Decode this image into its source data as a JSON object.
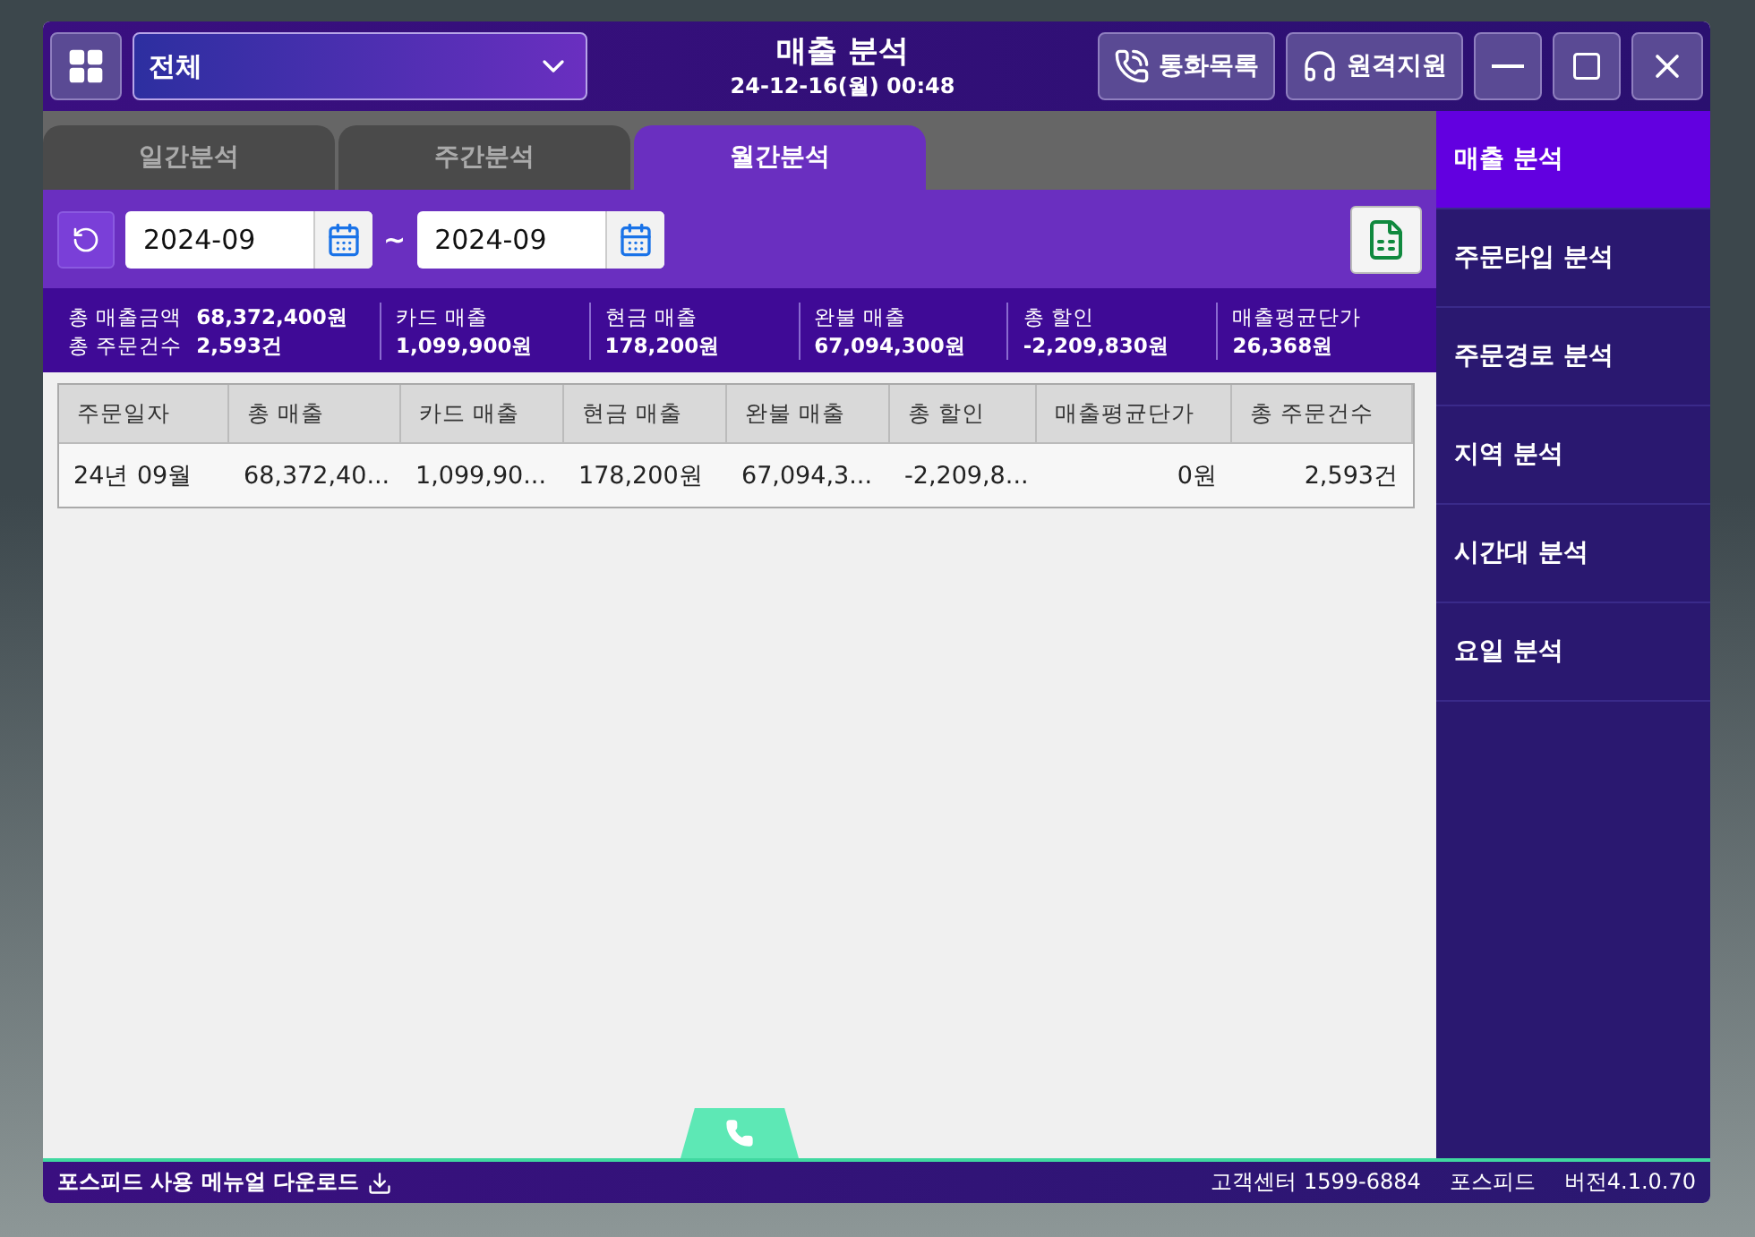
{
  "header": {
    "store_select": "전체",
    "title": "매출 분석",
    "datetime": "24-12-16(월) 00:48",
    "buttons": [
      {
        "kind": "calls",
        "label": "통화목록"
      },
      {
        "kind": "support",
        "label": "원격지원"
      }
    ]
  },
  "tabs": [
    {
      "label": "일간분석",
      "selected": false
    },
    {
      "label": "주간분석",
      "selected": false
    },
    {
      "label": "월간분석",
      "selected": true
    }
  ],
  "date_range": {
    "from": "2024-09",
    "separator": "~",
    "to": "2024-09"
  },
  "summary": [
    {
      "lines": [
        {
          "label": "총 매출금액",
          "value": "68,372,400원"
        },
        {
          "label": "총 주문건수",
          "value": "2,593건"
        }
      ]
    },
    {
      "lines": [
        {
          "label": "카드 매출",
          "value": "1,099,900원"
        }
      ]
    },
    {
      "lines": [
        {
          "label": "현금 매출",
          "value": "178,200원"
        }
      ]
    },
    {
      "lines": [
        {
          "label": "완불 매출",
          "value": "67,094,300원"
        }
      ]
    },
    {
      "lines": [
        {
          "label": "총 할인",
          "value": "-2,209,830원"
        }
      ]
    },
    {
      "lines": [
        {
          "label": "매출평균단가",
          "value": "26,368원"
        }
      ]
    }
  ],
  "table": {
    "columns": [
      "주문일자",
      "총 매출",
      "카드 매출",
      "현금 매출",
      "완불 매출",
      "총 할인",
      "매출평균단가",
      "총 주문건수"
    ],
    "rows": [
      [
        "24년 09월",
        "68,372,40...",
        "1,099,90...",
        "178,200원",
        "67,094,3...",
        "-2,209,8...",
        "0원",
        "2,593건"
      ]
    ]
  },
  "sidebar": [
    {
      "label": "매출 분석",
      "selected": true
    },
    {
      "label": "주문타입 분석",
      "selected": false
    },
    {
      "label": "주문경로 분석",
      "selected": false
    },
    {
      "label": "지역 분석",
      "selected": false
    },
    {
      "label": "시간대 분석",
      "selected": false
    },
    {
      "label": "요일 분석",
      "selected": false
    }
  ],
  "footer": {
    "manual": "포스피드 사용 메뉴얼 다운로드",
    "support": "고객센터 1599-6884",
    "brand": "포스피드",
    "version": "버전4.1.0.70"
  }
}
